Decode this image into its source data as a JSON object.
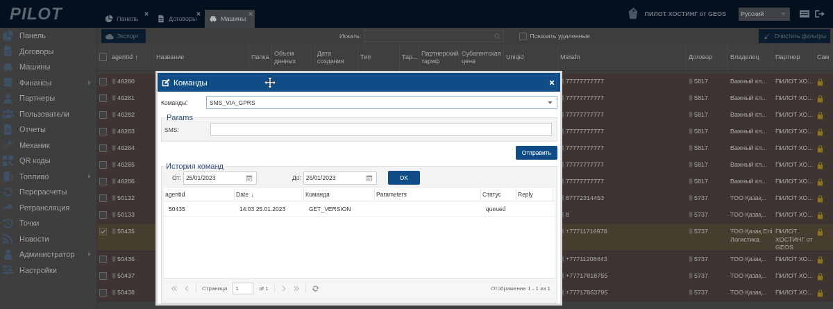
{
  "header": {
    "logo": "PILOT",
    "tabs": [
      {
        "label": "Панель",
        "selected": false
      },
      {
        "label": "Договоры",
        "selected": false
      },
      {
        "label": "Машины",
        "selected": true
      }
    ],
    "brand": "ПИЛОТ ХОСТИНГ от GEOS",
    "language": "Русский"
  },
  "sidebar": {
    "items": [
      {
        "label": "Панель",
        "submenu": false
      },
      {
        "label": "Договоры",
        "submenu": false
      },
      {
        "label": "Машины",
        "submenu": false
      },
      {
        "label": "Финансы",
        "submenu": true
      },
      {
        "label": "Партнеры",
        "submenu": false
      },
      {
        "label": "Пользователи",
        "submenu": false
      },
      {
        "label": "Отчеты",
        "submenu": false
      },
      {
        "label": "Механик",
        "submenu": false
      },
      {
        "label": "QR коды",
        "submenu": false
      },
      {
        "label": "Топливо",
        "submenu": true
      },
      {
        "label": "Перерасчеты",
        "submenu": false
      },
      {
        "label": "Ретрансляция",
        "submenu": false
      },
      {
        "label": "Точки",
        "submenu": false
      },
      {
        "label": "Новости",
        "submenu": false
      },
      {
        "label": "Администратор",
        "submenu": true
      },
      {
        "label": "Настройки",
        "submenu": false
      }
    ]
  },
  "toolbar": {
    "export_button": "Экспорт",
    "search_label": "Искать:",
    "show_deleted": {
      "label": "Показать удаленные",
      "checked": false
    },
    "clear_filters_button": "Очистить фильтры"
  },
  "table": {
    "select_all_checked": false,
    "columns": [
      {
        "label": "agentId",
        "sort_mark": "↑"
      },
      {
        "label": "Название"
      },
      {
        "label": "Папка"
      },
      {
        "label": "Объем данных"
      },
      {
        "label": "Дата создания"
      },
      {
        "label": "Тип"
      },
      {
        "label": "Тар..."
      },
      {
        "label": "Партнерский тариф"
      },
      {
        "label": "Субагентская цена"
      },
      {
        "label": "Uniqid"
      },
      {
        "label": "Msisdn"
      },
      {
        "label": "Договор"
      },
      {
        "label": "Владелец"
      },
      {
        "label": "Партнер"
      },
      {
        "label": "Сам"
      }
    ],
    "rows": [
      {
        "agent_id": "46280",
        "msisdn": "77777777777",
        "contract": "5817",
        "owner": "Важный кл...",
        "partner": "ПИЛОТ ХО...",
        "checked": false,
        "selected": false
      },
      {
        "agent_id": "46281",
        "msisdn": "77777777777",
        "contract": "5817",
        "owner": "Важный кл...",
        "partner": "ПИЛОТ ХО...",
        "checked": false,
        "selected": false
      },
      {
        "agent_id": "46282",
        "msisdn": "77777777777",
        "contract": "5817",
        "owner": "Важный кл...",
        "partner": "ПИЛОТ ХО...",
        "checked": false,
        "selected": false
      },
      {
        "agent_id": "46283",
        "msisdn": "77777777777",
        "contract": "5817",
        "owner": "Важный кл...",
        "partner": "ПИЛОТ ХО...",
        "checked": false,
        "selected": false
      },
      {
        "agent_id": "46284",
        "msisdn": "77777777777",
        "contract": "5817",
        "owner": "Важный кл...",
        "partner": "ПИЛОТ ХО...",
        "checked": false,
        "selected": false
      },
      {
        "agent_id": "46285",
        "msisdn": "77777777777",
        "contract": "5817",
        "owner": "Важный кл...",
        "partner": "ПИЛОТ ХО...",
        "checked": false,
        "selected": false
      },
      {
        "agent_id": "46286",
        "msisdn": "77777777777",
        "contract": "5817",
        "owner": "Важный кл...",
        "partner": "ПИЛОТ ХО...",
        "checked": false,
        "selected": false
      },
      {
        "agent_id": "50132",
        "msisdn": "87772314453",
        "contract": "5737",
        "owner": "ТОО Қазақ...",
        "partner": "ПИЛОТ ХО...",
        "checked": false,
        "selected": false
      },
      {
        "agent_id": "50133",
        "msisdn": "8",
        "contract": "5737",
        "owner": "ТОО Қазақ...",
        "partner": "ПИЛОТ ХО...",
        "checked": false,
        "selected": false
      },
      {
        "agent_id": "50435",
        "msisdn": "+77711716978",
        "contract": "5737",
        "owner": "ТОО Қазақ Елі Логистика",
        "partner": "ПИЛОТ ХОСТИНГ от GEOS",
        "checked": true,
        "selected": true
      },
      {
        "agent_id": "50436",
        "msisdn": "+77711208443",
        "contract": "5737",
        "owner": "ТОО Қазақ...",
        "partner": "ПИЛОТ ХО...",
        "checked": false,
        "selected": false
      },
      {
        "agent_id": "50437",
        "msisdn": "+77717818755",
        "contract": "5737",
        "owner": "ТОО Қазақ...",
        "partner": "ПИЛОТ ХО...",
        "checked": false,
        "selected": false
      },
      {
        "agent_id": "50438",
        "msisdn": "+77717863795",
        "contract": "5737",
        "owner": "ТОО Қазақ...",
        "partner": "ПИЛОТ ХО...",
        "checked": false,
        "selected": false
      }
    ]
  },
  "dialog": {
    "title": "Команды",
    "command_label": "Команды:",
    "command_value": "SMS_VIA_GPRS",
    "params_legend": "Params",
    "sms_label": "SMS:",
    "send_button": "Отправить",
    "history_legend": "История команд",
    "from_label": "От:",
    "from_value": "25/01/2023",
    "to_label": "До:",
    "to_value": "26/01/2023",
    "ok_button": "OK",
    "columns": [
      {
        "label": "agentId"
      },
      {
        "label": "Date",
        "sort_mark": "↓"
      },
      {
        "label": "Команда"
      },
      {
        "label": "Parameters"
      },
      {
        "label": "Статус"
      },
      {
        "label": "Reply"
      }
    ],
    "rows": [
      {
        "agent_id": "50435",
        "date": "14:03 25.01.2023",
        "command": "GET_VERSION",
        "status": "queued"
      }
    ],
    "pager": {
      "page_label": "Страница",
      "page_value": "1",
      "page_of": "of 1",
      "summary": "Отображение 1 - 1 из 1"
    }
  }
}
